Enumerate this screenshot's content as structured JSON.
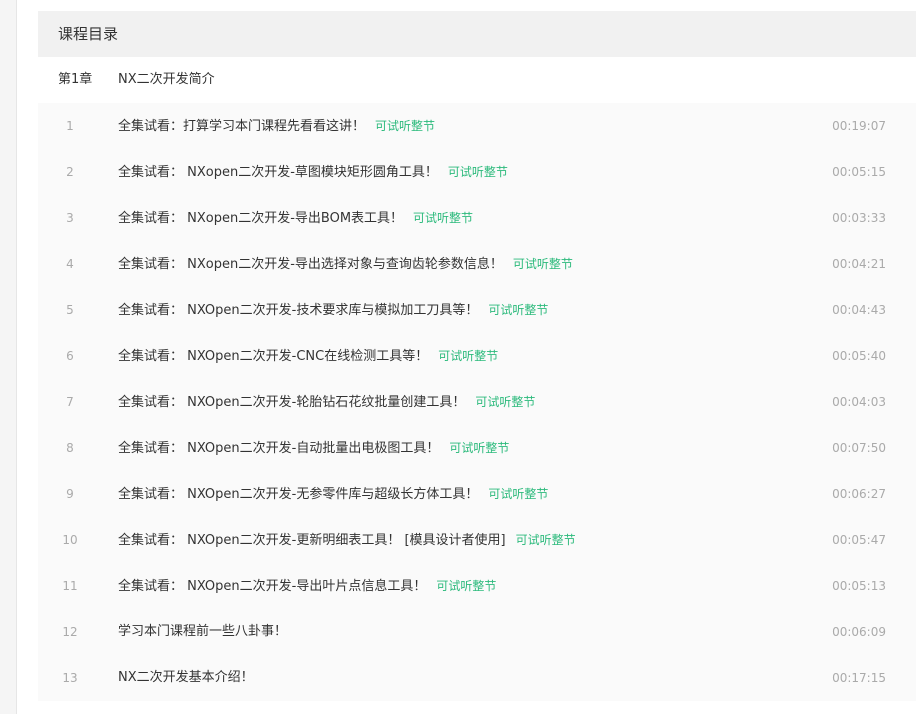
{
  "header": {
    "title": "课程目录"
  },
  "chapter": {
    "number": "第1章",
    "title": "NX二次开发简介"
  },
  "tag_color": "#2cba7c",
  "lessons": [
    {
      "n": "1",
      "title": "全集试看：打算学习本门课程先看看这讲！",
      "tag": "可试听整节",
      "duration": "00:19:07"
    },
    {
      "n": "2",
      "title": "全集试看： NXopen二次开发-草图模块矩形圆角工具！",
      "tag": "可试听整节",
      "duration": "00:05:15"
    },
    {
      "n": "3",
      "title": "全集试看： NXopen二次开发-导出BOM表工具！",
      "tag": "可试听整节",
      "duration": "00:03:33"
    },
    {
      "n": "4",
      "title": "全集试看： NXopen二次开发-导出选择对象与查询齿轮参数信息！",
      "tag": "可试听整节",
      "duration": "00:04:21"
    },
    {
      "n": "5",
      "title": "全集试看： NXOpen二次开发-技术要求库与模拟加工刀具等！",
      "tag": "可试听整节",
      "duration": "00:04:43"
    },
    {
      "n": "6",
      "title": "全集试看： NXOpen二次开发-CNC在线检测工具等！",
      "tag": "可试听整节",
      "duration": "00:05:40"
    },
    {
      "n": "7",
      "title": "全集试看： NXOpen二次开发-轮胎钻石花纹批量创建工具！",
      "tag": "可试听整节",
      "duration": "00:04:03"
    },
    {
      "n": "8",
      "title": "全集试看： NXOpen二次开发-自动批量出电极图工具！",
      "tag": "可试听整节",
      "duration": "00:07:50"
    },
    {
      "n": "9",
      "title": "全集试看： NXOpen二次开发-无参零件库与超级长方体工具！",
      "tag": "可试听整节",
      "duration": "00:06:27"
    },
    {
      "n": "10",
      "title": "全集试看： NXOpen二次开发-更新明细表工具！ [模具设计者使用]",
      "tag": "可试听整节",
      "duration": "00:05:47"
    },
    {
      "n": "11",
      "title": "全集试看： NXOpen二次开发-导出叶片点信息工具！",
      "tag": "可试听整节",
      "duration": "00:05:13"
    },
    {
      "n": "12",
      "title": "学习本门课程前一些八卦事！",
      "tag": "",
      "duration": "00:06:09"
    },
    {
      "n": "13",
      "title": "NX二次开发基本介绍！",
      "tag": "",
      "duration": "00:17:15"
    }
  ]
}
